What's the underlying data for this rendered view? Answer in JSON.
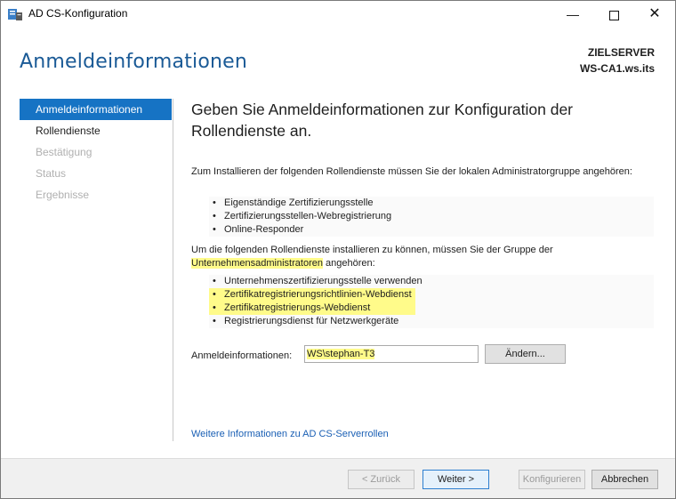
{
  "window": {
    "title": "AD CS-Konfiguration",
    "minimize_glyph": "—",
    "close_glyph": "✕"
  },
  "header": {
    "page_title": "Anmeldeinformationen",
    "server_caption": "ZIELSERVER",
    "server_name": "WS-CA1.ws.its"
  },
  "nav": {
    "items": [
      {
        "label": "Anmeldeinformationen",
        "state": "active"
      },
      {
        "label": "Rollendienste",
        "state": "enabled"
      },
      {
        "label": "Bestätigung",
        "state": "disabled"
      },
      {
        "label": "Status",
        "state": "disabled"
      },
      {
        "label": "Ergebnisse",
        "state": "disabled"
      }
    ]
  },
  "main": {
    "heading": "Geben Sie Anmeldeinformationen zur Konfiguration der Rollendienste an.",
    "local_admin_text": "Zum Installieren der folgenden Rollendienste müssen Sie der lokalen Administratorgruppe angehören:",
    "local_services": [
      "Eigenständige Zertifizierungsstelle",
      "Zertifizierungsstellen-Webregistrierung",
      "Online-Responder"
    ],
    "enterprise_text_1": "Um die folgenden Rollendienste installieren zu können, müssen Sie der Gruppe der",
    "enterprise_group": "Unternehmensadministratoren",
    "enterprise_text_2": " angehören:",
    "enterprise_services": [
      "Unternehmenszertifizierungsstelle verwenden",
      "Zertifikatregistrierungsrichtlinien-Webdienst",
      "Zertifikatregistrierungs-Webdienst",
      "Registrierungsdienst für Netzwerkgeräte"
    ],
    "credentials_label": "Anmeldeinformationen:",
    "credentials_value": "WS\\stephan-T3",
    "change_button": "Ändern...",
    "more_info_link": "Weitere Informationen zu AD CS-Serverrollen"
  },
  "footer": {
    "back": "< Zurück",
    "next": "Weiter >",
    "configure": "Konfigurieren",
    "cancel": "Abbrechen"
  },
  "colors": {
    "accent": "#1673c4",
    "heading": "#1a5a96",
    "highlight": "#fffb8a",
    "link": "#1a5fb4"
  }
}
